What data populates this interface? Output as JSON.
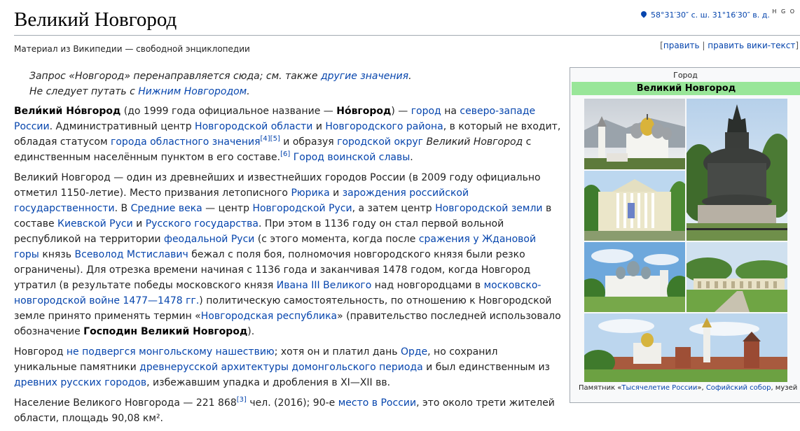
{
  "page": {
    "title": "Великий Новгород",
    "tagline": "Материал из Википедии — свободной энциклопедии",
    "coordinates": "58°31′30″ с. ш. 31°16′30″ в. д.",
    "coord_extra": "H G O",
    "edit": {
      "open": "[",
      "edit": "править",
      "sep": " | ",
      "edit_source": "править вики-текст",
      "close": "]"
    }
  },
  "hatnote": {
    "line1_pre": "Запрос «Новгород» перенаправляется сюда; см. также ",
    "line1_link": "другие значения",
    "line1_post": ".",
    "line2_pre": "Не следует путать с ",
    "line2_link": "Нижним Новгородом",
    "line2_post": "."
  },
  "paragraphs": {
    "p1": {
      "b1": "Вели́кий Но́вгород",
      "t1": " (до 1999 года официальное название — ",
      "b2": "Но́вгород",
      "t2": ") — ",
      "l1": "город",
      "t3": " на ",
      "l2": "северо-западе России",
      "t4": ". Административный центр ",
      "l3": "Новгородской области",
      "t5": " и ",
      "l4": "Новгородского района",
      "t6": ", в который не входит, обладая статусом ",
      "l5": "города областного значения",
      "r1": "[4][5]",
      "t7": " и образуя ",
      "l6": "городской округ",
      "t8": " ",
      "i1": "Великий Новгород",
      "t9": " с единственным населённым пунктом в его составе.",
      "r2": "[6]",
      "t10": " ",
      "l7": "Город воинской славы",
      "t11": "."
    },
    "p2": {
      "t1": "Великий Новгород — один из древнейших и известнейших городов России (в 2009 году официально отметил 1150-летие). Место призвания летописного ",
      "l1": "Рюрика",
      "t2": " и ",
      "l2": "зарождения российской государственности",
      "t3": ". В ",
      "l3": "Средние века",
      "t4": " — центр ",
      "l4": "Новгородской Руси",
      "t5": ", а затем центр ",
      "l5": "Новгородской земли",
      "t6": " в составе ",
      "l6": "Киевской Руси",
      "t7": " и ",
      "l7": "Русского государства",
      "t8": ". При этом в 1136 году он стал первой вольной республикой на территории ",
      "l8": "феодальной Руси",
      "t9": " (с этого момента, когда после ",
      "l9": "сражения у Ждановой горы",
      "t10": " князь ",
      "l10": "Всеволод Мстиславич",
      "t11": " бежал с поля боя, полномочия новгородского князя были резко ограничены). Для отрезка времени начиная с 1136 года и заканчивая 1478 годом, когда Новгород утратил (в результате победы московского князя ",
      "l11": "Ивана III Великого",
      "t12": " над новгородцами в ",
      "l12": "московско-новгородской войне 1477—1478 гг.",
      "t13": ") политическую самостоятельность, по отношению к Новгородской земле принято применять термин «",
      "l13": "Новгородская республика",
      "t14": "» (правительство последней использовало обозначение ",
      "b1": "Господин Великий Новгород",
      "t15": ")."
    },
    "p3": {
      "t1": "Новгород ",
      "l1": "не подвергся монгольскому нашествию",
      "t2": "; хотя он и платил дань ",
      "l2": "Орде",
      "t3": ", но сохранил уникальные памятники ",
      "l3": "древнерусской архитектуры домонгольского периода",
      "t4": " и был единственным из ",
      "l4": "древних русских городов",
      "t5": ", избежавшим упадка и дробления в XI—XII вв."
    },
    "p4": {
      "t1": "Население Великого Новгорода — 221 868",
      "r1": "[3]",
      "t2": " чел. (2016); 90-е ",
      "l1": "место в России",
      "t3": ", это около трети жителей области, площадь 90,08 км²."
    }
  },
  "infobox": {
    "type": "Город",
    "name": "Великий Новгород",
    "caption_pre": "Памятник «",
    "caption_link1": "Тысячелетие России",
    "caption_mid": "», ",
    "caption_link2": "Софийский собор",
    "caption_post": ", музей"
  },
  "colors": {
    "link": "#0645ad",
    "infobox_header": "#99e699",
    "border": "#a2a9b1"
  }
}
